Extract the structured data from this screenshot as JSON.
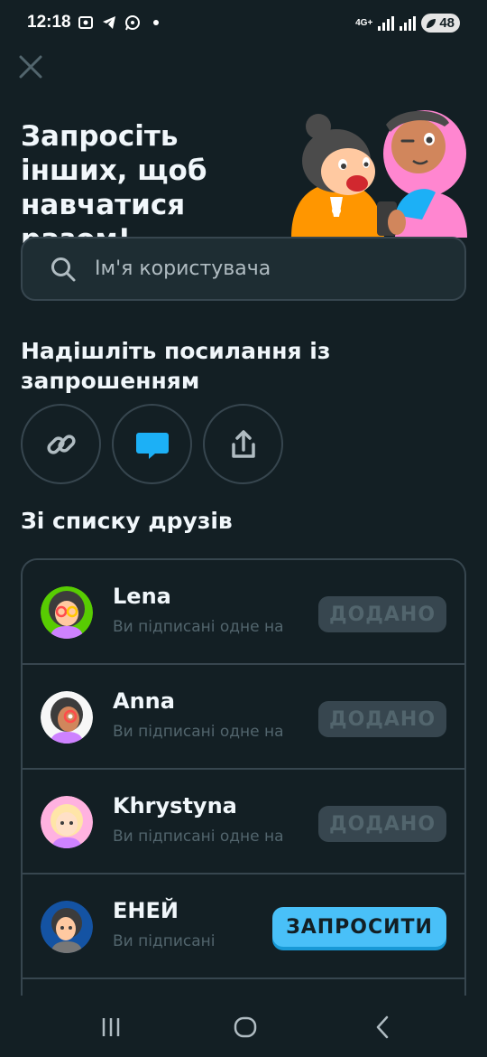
{
  "status_bar": {
    "time": "12:18",
    "network": "4G+",
    "battery": "48"
  },
  "hero": {
    "title": "Запросіть інших, щоб навчатися разом!"
  },
  "search": {
    "placeholder": "Ім'я користувача"
  },
  "share": {
    "title": "Надішліть посилання із запрошенням",
    "buttons": [
      {
        "icon": "link-icon"
      },
      {
        "icon": "message-icon"
      },
      {
        "icon": "share-icon"
      }
    ]
  },
  "friends": {
    "title": "Зі списку друзів",
    "items": [
      {
        "name": "Lena",
        "subtitle": "Ви підписані одне на",
        "action": "ДОДАНО"
      },
      {
        "name": "Anna",
        "subtitle": "Ви підписані одне на",
        "action": "ДОДАНО"
      },
      {
        "name": "Khrystyna",
        "subtitle": "Ви підписані одне на",
        "action": "ДОДАНО"
      },
      {
        "name": "ЕНЕЙ",
        "subtitle": "Ви підписані",
        "action": "ЗАПРОСИТИ"
      }
    ]
  },
  "colors": {
    "background": "#131f24",
    "border": "#37464f",
    "accent_blue": "#49c0f8",
    "muted": "#52656d"
  }
}
